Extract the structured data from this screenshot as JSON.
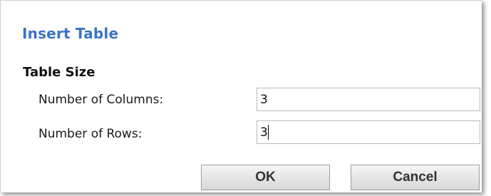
{
  "dialog": {
    "title": "Insert Table",
    "section_heading": "Table Size",
    "fields": {
      "columns": {
        "label": "Number of Columns:",
        "value": "3"
      },
      "rows": {
        "label": "Number of Rows:",
        "value": "3"
      }
    },
    "buttons": {
      "ok_label": "OK",
      "cancel_label": "Cancel"
    }
  },
  "colors": {
    "title": "#3a73c4",
    "text": "#111111",
    "input_border": "#b9b9b9"
  }
}
